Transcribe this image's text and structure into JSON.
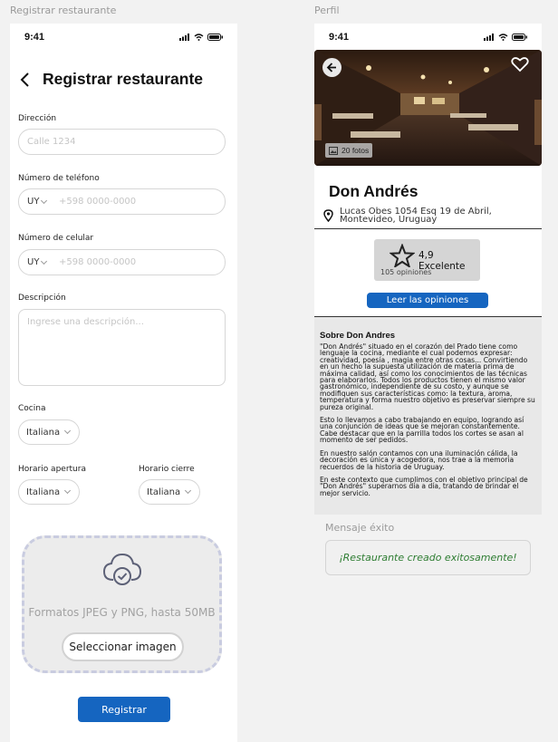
{
  "frames": {
    "register_label": "Registrar restaurante",
    "profile_label": "Perfil",
    "success_label": "Mensaje éxito"
  },
  "status": {
    "time": "9:41"
  },
  "register": {
    "title": "Registrar restaurante",
    "address": {
      "label": "Dirección",
      "placeholder": "Calle 1234"
    },
    "phone": {
      "label": "Número de teléfono",
      "country": "UY",
      "placeholder": "+598 0000-0000"
    },
    "mobile": {
      "label": "Número de celular",
      "country": "UY",
      "placeholder": "+598 0000-0000"
    },
    "description": {
      "label": "Descripción",
      "placeholder": "Ingrese una descripción..."
    },
    "cuisine": {
      "label": "Cocina",
      "value": "Italiana"
    },
    "opening": {
      "label": "Horario apertura",
      "value": "Italiana"
    },
    "closing": {
      "label": "Horario cierre",
      "value": "Italiana"
    },
    "upload": {
      "formats": "Formatos JPEG y PNG, hasta 50MB",
      "button": "Seleccionar imagen"
    },
    "submit": "Registrar"
  },
  "profile": {
    "photos": "20 fotos",
    "name": "Don Andrés",
    "address_line1": "Lucas Obes 1054 Esq 19 de Abril,",
    "address_line2": "Montevideo, Uruguay",
    "rating": "4,9 Excelente",
    "reviews": "105 opiniones",
    "read_reviews": "Leer las opiniones",
    "about_title": "Sobre Don Andres",
    "about": [
      "\"Don Andrés\" situado en el corazón del Prado tiene como lenguaje la cocina, mediante el cual podemos expresar: creatividad, poesía , magia entre otras cosas... Convirtiendo en un hecho la supuesta utilización de materia prima de máxima calidad, así como los conocimientos de las técnicas para elaborarlos. Todos los productos tienen el mismo valor gastronómico, independiente de su costo, y aunque se modifiquen sus características como: la textura, aroma, temperatura y forma nuestro objetivo es preservar siempre su pureza original.",
      "Esto lo llevamos a cabo trabajando en equipo, logrando así una conjunción de ideas que se mejoran constantemente. Cabe destacar que en la parrilla todos los cortes se asan al momento de ser pedidos.",
      "En nuestro salón contamos con una iluminación cálida, la decoración es única y acogedora, nos trae a la memoria recuerdos de la historia de Uruguay.",
      "En este contexto que cumplimos con el objetivo principal de \"Don Andrés\" superarnos día a día, tratando de brindar el mejor servicio."
    ]
  },
  "success": {
    "message": "¡Restaurante creado exitosamente!"
  },
  "colors": {
    "primary": "#1565c0",
    "success_text": "#2e7d32"
  }
}
